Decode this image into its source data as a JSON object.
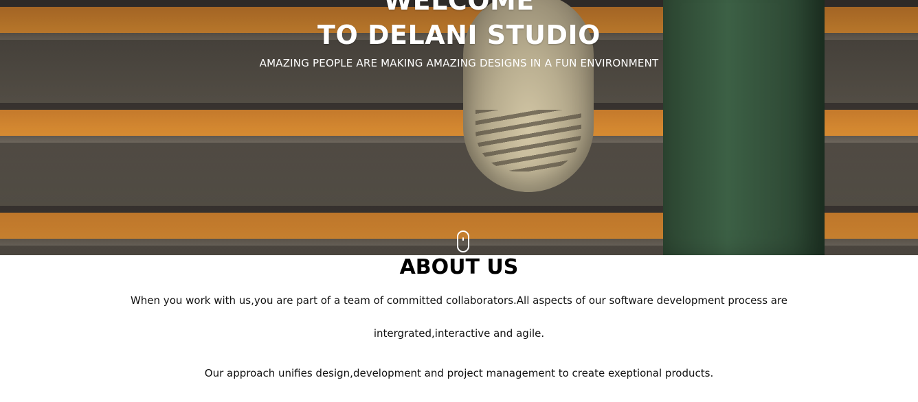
{
  "hero": {
    "title_line1": "WELCOME",
    "title_line2": "TO DELANI STUDIO",
    "subtitle": "AMAZING PEOPLE ARE MAKING AMAZING DESIGNS IN A FUN ENVIRONMENT",
    "scroll_icon": "mouse-scroll-icon"
  },
  "about": {
    "heading": "ABOUT US",
    "paragraph1": "When you work with us,you are part of a team of committed collaborators.All aspects of our software development process are intergrated,interactive and agile.",
    "paragraph2": "Our approach unifies design,development and project management to create exeptional products."
  },
  "colors": {
    "hero_text": "#ffffff",
    "accent_orange": "#f29a32",
    "body_text": "#111111"
  }
}
